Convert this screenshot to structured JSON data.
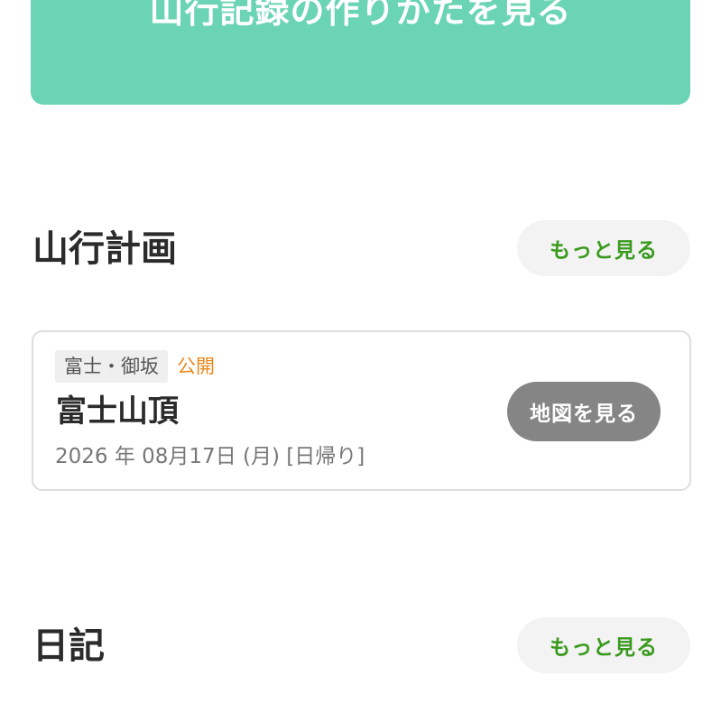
{
  "banner": {
    "howto_label": "山行記録の作りかたを見る",
    "color": "#6ad4b4"
  },
  "plans": {
    "title": "山行計画",
    "more_label": "もっと見る",
    "items": [
      {
        "area": "富士・御坂",
        "visibility": "公開",
        "name": "富士山頂",
        "date": "2026 年 08月17日 (月) [日帰り]",
        "map_label": "地図を見る"
      }
    ]
  },
  "diary": {
    "title": "日記",
    "more_label": "もっと見る"
  },
  "colors": {
    "accent_green": "#3a9a1e",
    "public_orange": "#e8891c",
    "map_button": "#858585"
  }
}
